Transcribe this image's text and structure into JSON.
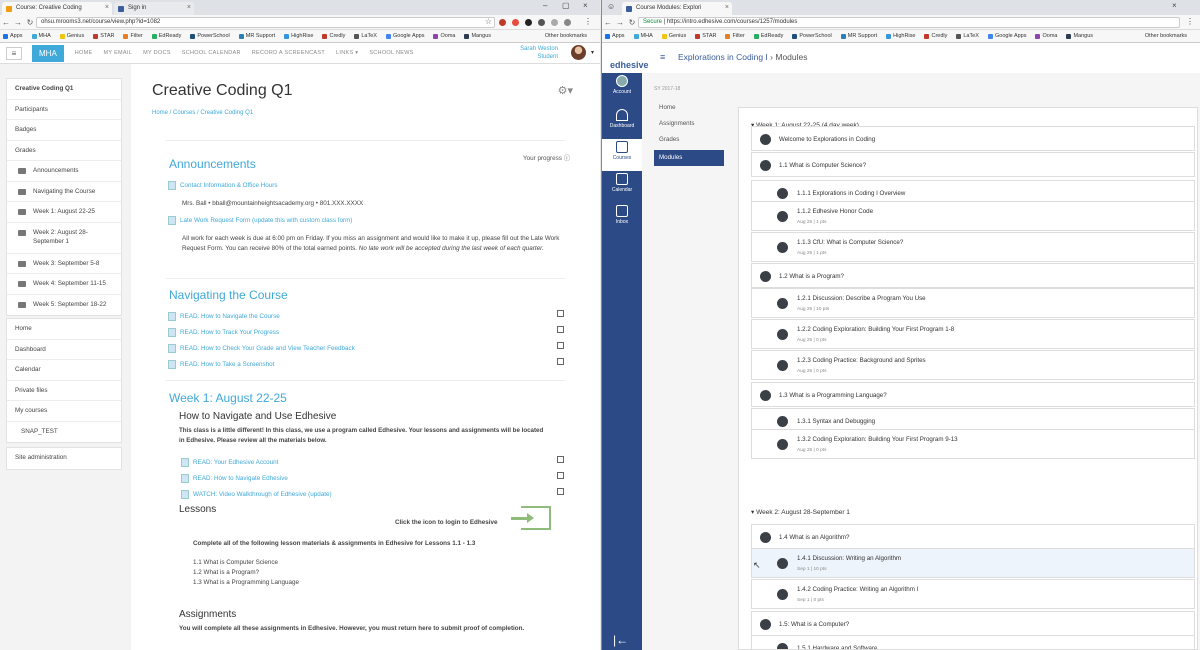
{
  "left_window": {
    "tabs": [
      {
        "label": "Course: Creative Coding",
        "active": true
      },
      {
        "label": "Sign in",
        "active": false
      }
    ],
    "url": "ohsu.mrooms3.net/course/view.php?id=1082",
    "bookmarks": [
      "Apps",
      "MHA",
      "Genius",
      "STAR",
      "Filter",
      "EdReady",
      "PowerSchool",
      "MR Support",
      "HighRise",
      "Credly",
      "LaTeX",
      "Google Apps",
      "Ooma",
      "Mangus"
    ],
    "other_bookmarks": "Other bookmarks",
    "site": {
      "brand": "MHA",
      "nav": [
        "HOME",
        "MY EMAIL",
        "MY DOCS",
        "SCHOOL CALENDAR",
        "RECORD A SCREENCAST",
        "LINKS ▾",
        "SCHOOL NEWS"
      ],
      "user_name": "Sarah Weston",
      "user_role": "Student"
    },
    "sidebar": {
      "course": [
        "Creative Coding Q1",
        "Participants",
        "Badges",
        "Grades"
      ],
      "sections": [
        "Announcements",
        "Navigating the Course",
        "Week 1: August 22-25",
        "Week 2: August 28-September 1",
        "Week 3: September 5-8",
        "Week 4: September 11-15",
        "Week 5: September 18-22"
      ],
      "global": [
        "Home",
        "Dashboard",
        "Calendar",
        "Private files",
        "My courses",
        "SNAP_TEST"
      ],
      "admin": "Site administration"
    },
    "main": {
      "title": "Creative Coding Q1",
      "breadcrumb": [
        "Home",
        "Courses",
        "Creative Coding Q1"
      ],
      "progress_label": "Your progress",
      "announcements": {
        "heading": "Announcements",
        "link1": "Contact Information & Office Hours",
        "contact": "Mrs. Ball • bball@mountainheightsacademy.org  • 801.XXX.XXXX",
        "link2": "Late Work Request Form (update this with custom class form)",
        "policy": "All work for each week is due at 6:00 pm on Friday.  If you miss an assignment and would like to make it up, please fill out the Late Work Request Form.  You can receive 80% of the total earned points.",
        "policy_italic": "No late work will be accepted during the last week of each quarter."
      },
      "navigating": {
        "heading": "Navigating the Course",
        "links": [
          "READ: How to Navigate the Course",
          "READ: How to Track Your Progress",
          "READ: How to Check Your Grade and View Teacher Feedback",
          "READ: How to Take a Screenshot"
        ]
      },
      "week1": {
        "heading": "Week 1: August 22-25",
        "subheading": "How to Navigate and Use Edhesive",
        "intro": "This class is a little different!  In this class, we use a program called Edhesive.  Your lessons and assignments will be located in Edhesive.  Please review all the materials below.",
        "links": [
          "READ: Your Edhesive Account",
          "READ: How to Navigate Edhesive",
          "WATCH: Video Walkthrough of Edhesive (update)"
        ],
        "lessons_heading": "Lessons",
        "login_text": "Click the icon to login to Edhesive",
        "complete_text": "Complete all of the following lesson materials & assignments in Edhesive for Lessons 1.1 - 1.3",
        "lesson_list": [
          "1.1 What is Computer Science",
          "1.2 What is a Program?",
          "1.3 What is a Programming Language"
        ],
        "assignments_heading": "Assignments",
        "assignments_text": "You will complete all these assignments in Edhesive. However, you must return here to submit proof of completion."
      }
    }
  },
  "right_window": {
    "tab": "Course Modules: Explori",
    "secure": "Secure",
    "url": "https://intro.edhesive.com/courses/1257/modules",
    "bookmarks": [
      "Apps",
      "MHA",
      "Genius",
      "STAR",
      "Filter",
      "EdReady",
      "PowerSchool",
      "MR Support",
      "HighRise",
      "Credly",
      "LaTeX",
      "Google Apps",
      "Ooma",
      "Mangus"
    ],
    "other_bookmarks": "Other bookmarks",
    "logo": "edhesive",
    "breadcrumb": {
      "course": "Explorations in Coding I",
      "sep": "›",
      "page": "Modules"
    },
    "rail": [
      "Account",
      "Dashboard",
      "Courses",
      "Calendar",
      "Inbox"
    ],
    "term": "SY 2017-18",
    "course_nav": [
      "Home",
      "Assignments",
      "Grades",
      "Modules"
    ],
    "week1": "Week 1: August 22-25 (4 day week)",
    "week2": "Week 2: August 28-September 1",
    "items": [
      {
        "title": "Welcome to Explorations in Coding",
        "meta": ""
      },
      {
        "title": "1.1 What is Computer Science?",
        "meta": ""
      },
      {
        "title": "1.1.1 Explorations in Coding I Overview",
        "meta": ""
      },
      {
        "title": "1.1.2 Edhesive Honor Code",
        "meta": "Aug 25  |  1 pts"
      },
      {
        "title": "1.1.3 CfU: What is Computer Science?",
        "meta": "Aug 25  |  1 pts"
      },
      {
        "title": "1.2 What is a Program?",
        "meta": ""
      },
      {
        "title": "1.2.1 Discussion: Describe a Program You Use",
        "meta": "Aug 25  |  10 pts"
      },
      {
        "title": "1.2.2 Coding Exploration: Building Your First Program 1-8",
        "meta": "Aug 25  |  0 pts"
      },
      {
        "title": "1.2.3 Coding Practice: Background and Sprites",
        "meta": "Aug 25  |  0 pts"
      },
      {
        "title": "1.3 What is a Programming Language?",
        "meta": ""
      },
      {
        "title": "1.3.1 Syntax and Debugging",
        "meta": ""
      },
      {
        "title": "1.3.2 Coding Exploration: Building Your First Program 9-13",
        "meta": "Aug 25  |  0 pts"
      },
      {
        "title": "1.4 What is an Algorithm?",
        "meta": ""
      },
      {
        "title": "1.4.1 Discussion: Writing an Algorithm",
        "meta": "Sep 1  |  10 pts"
      },
      {
        "title": "1.4.2 Coding Practice: Writing an Algorithm I",
        "meta": "Sep 1  |  0 pts"
      },
      {
        "title": "1.5: What is a Computer?",
        "meta": ""
      },
      {
        "title": "1.5.1 Hardware and Software",
        "meta": ""
      }
    ]
  }
}
